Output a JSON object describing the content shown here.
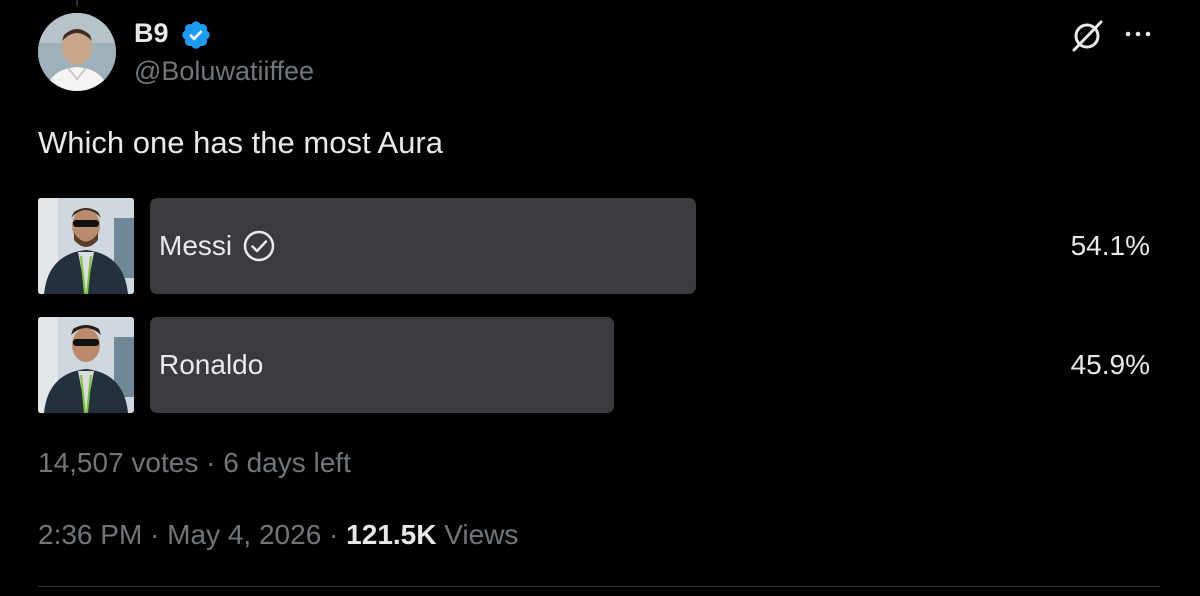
{
  "author": {
    "display_name": "B9",
    "handle": "@Boluwatiiffee",
    "verified": true,
    "avatar": "avatar-photo"
  },
  "header_actions": {
    "grok_icon": "grok-icon",
    "more_icon": "more-icon"
  },
  "tweet": {
    "text": "Which one has the most Aura"
  },
  "poll": {
    "options": [
      {
        "label": "Messi",
        "percent": "54.1%",
        "fraction": 0.541,
        "winner": true,
        "thumbnail": "messi-photo"
      },
      {
        "label": "Ronaldo",
        "percent": "45.9%",
        "fraction": 0.459,
        "winner": false,
        "thumbnail": "ronaldo-photo"
      }
    ],
    "votes": "14,507 votes",
    "separator": " · ",
    "time_left": "6 days left"
  },
  "meta": {
    "time": "2:36 PM",
    "date": "May 4, 2026",
    "views_count": "121.5K",
    "views_label": "Views",
    "separator": " · "
  },
  "colors": {
    "background": "#000000",
    "text": "#e7e9ea",
    "muted": "#71767b",
    "poll_bar": "#3a3b3e",
    "verified_blue": "#1d9bf0"
  }
}
